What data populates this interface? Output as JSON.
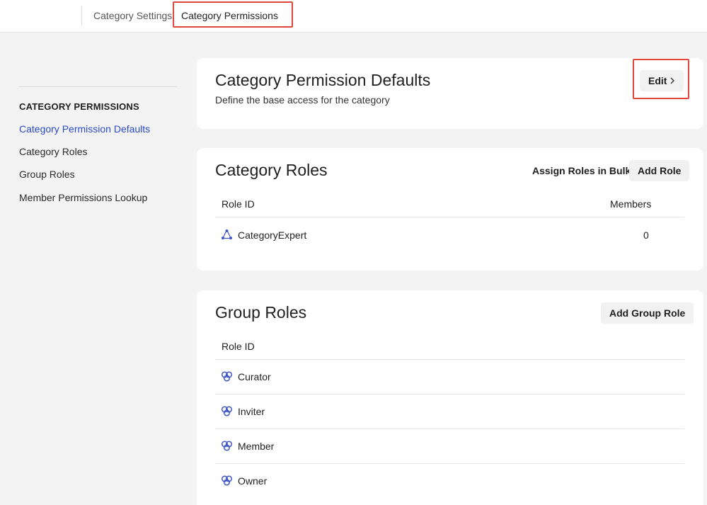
{
  "tabs": {
    "settings_label": "Category Settings",
    "permissions_label": "Category Permissions"
  },
  "sidebar": {
    "heading": "CATEGORY PERMISSIONS",
    "items": [
      {
        "label": "Category Permission Defaults",
        "active": true
      },
      {
        "label": "Category Roles"
      },
      {
        "label": "Group Roles"
      },
      {
        "label": "Member Permissions Lookup"
      }
    ]
  },
  "defaults_card": {
    "title": "Category Permission Defaults",
    "description": "Define the base access for the category",
    "edit_label": "Edit"
  },
  "category_roles_card": {
    "title": "Category Roles",
    "assign_bulk_label": "Assign Roles in Bulk",
    "add_role_label": "Add Role",
    "col_role_id": "Role ID",
    "col_members": "Members",
    "rows": [
      {
        "role": "CategoryExpert",
        "members": "0",
        "icon": "category-role-icon"
      }
    ]
  },
  "group_roles_card": {
    "title": "Group Roles",
    "add_group_role_label": "Add Group Role",
    "col_role_id": "Role ID",
    "rows": [
      {
        "role": "Curator",
        "icon": "group-role-icon"
      },
      {
        "role": "Inviter",
        "icon": "group-role-icon"
      },
      {
        "role": "Member",
        "icon": "group-role-icon"
      },
      {
        "role": "Owner",
        "icon": "group-role-icon"
      }
    ]
  },
  "colors": {
    "accent": "#2b4bc7",
    "highlight": "#e0463c",
    "icon": "#3f56c9"
  }
}
